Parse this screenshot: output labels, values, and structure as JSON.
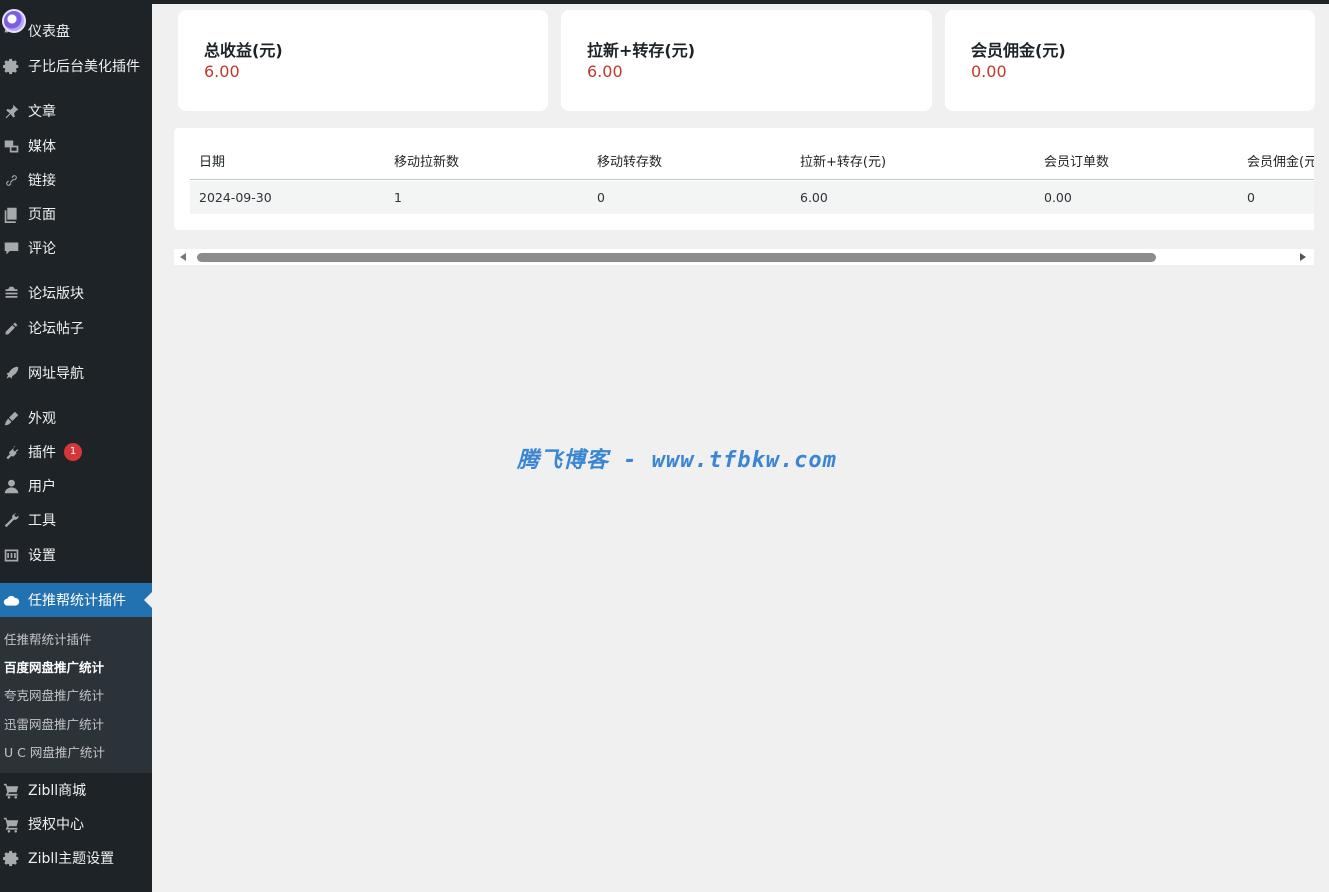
{
  "sidebar": {
    "menu": [
      {
        "label": "仪表盘",
        "icon": "dashboard-icon"
      },
      {
        "label": "子比后台美化插件",
        "icon": "gear-icon"
      },
      {
        "label": "文章",
        "icon": "pin-icon"
      },
      {
        "label": "媒体",
        "icon": "media-icon"
      },
      {
        "label": "链接",
        "icon": "link-icon"
      },
      {
        "label": "页面",
        "icon": "page-icon"
      },
      {
        "label": "评论",
        "icon": "comment-icon"
      },
      {
        "label": "论坛版块",
        "icon": "forum-icon"
      },
      {
        "label": "论坛帖子",
        "icon": "post-icon"
      },
      {
        "label": "网址导航",
        "icon": "rocket-icon"
      },
      {
        "label": "外观",
        "icon": "brush-icon"
      },
      {
        "label": "插件",
        "icon": "plugin-icon",
        "badge": "1"
      },
      {
        "label": "用户",
        "icon": "user-icon"
      },
      {
        "label": "工具",
        "icon": "wrench-icon"
      },
      {
        "label": "设置",
        "icon": "settings-icon"
      },
      {
        "label": "任推帮统计插件",
        "icon": "cloud-icon"
      },
      {
        "label": "Zibll商城",
        "icon": "cart-icon"
      },
      {
        "label": "授权中心",
        "icon": "cart-icon"
      },
      {
        "label": "Zibll主题设置",
        "icon": "gear-icon"
      }
    ],
    "submenu": [
      {
        "label": "任推帮统计插件"
      },
      {
        "label": "百度网盘推广统计"
      },
      {
        "label": "夸克网盘推广统计"
      },
      {
        "label": "迅雷网盘推广统计"
      },
      {
        "label": "U C 网盘推广统计"
      }
    ]
  },
  "cards": [
    {
      "label": "总收益(元)",
      "value": "6.00"
    },
    {
      "label": "拉新+转存(元)",
      "value": "6.00"
    },
    {
      "label": "会员佣金(元)",
      "value": "0.00"
    }
  ],
  "table": {
    "headers": [
      "日期",
      "移动拉新数",
      "移动转存数",
      "拉新+转存(元)",
      "会员订单数",
      "会员佣金(元)"
    ],
    "rows": [
      [
        "2024-09-30",
        "1",
        "0",
        "6.00",
        "0.00",
        "0"
      ]
    ]
  },
  "watermark": "腾飞博客 - www.tfbkw.com",
  "colors": {
    "sidebar_bg": "#1d2327",
    "accent": "#2271b1",
    "value_red": "#c0392b",
    "badge_red": "#d63638"
  }
}
